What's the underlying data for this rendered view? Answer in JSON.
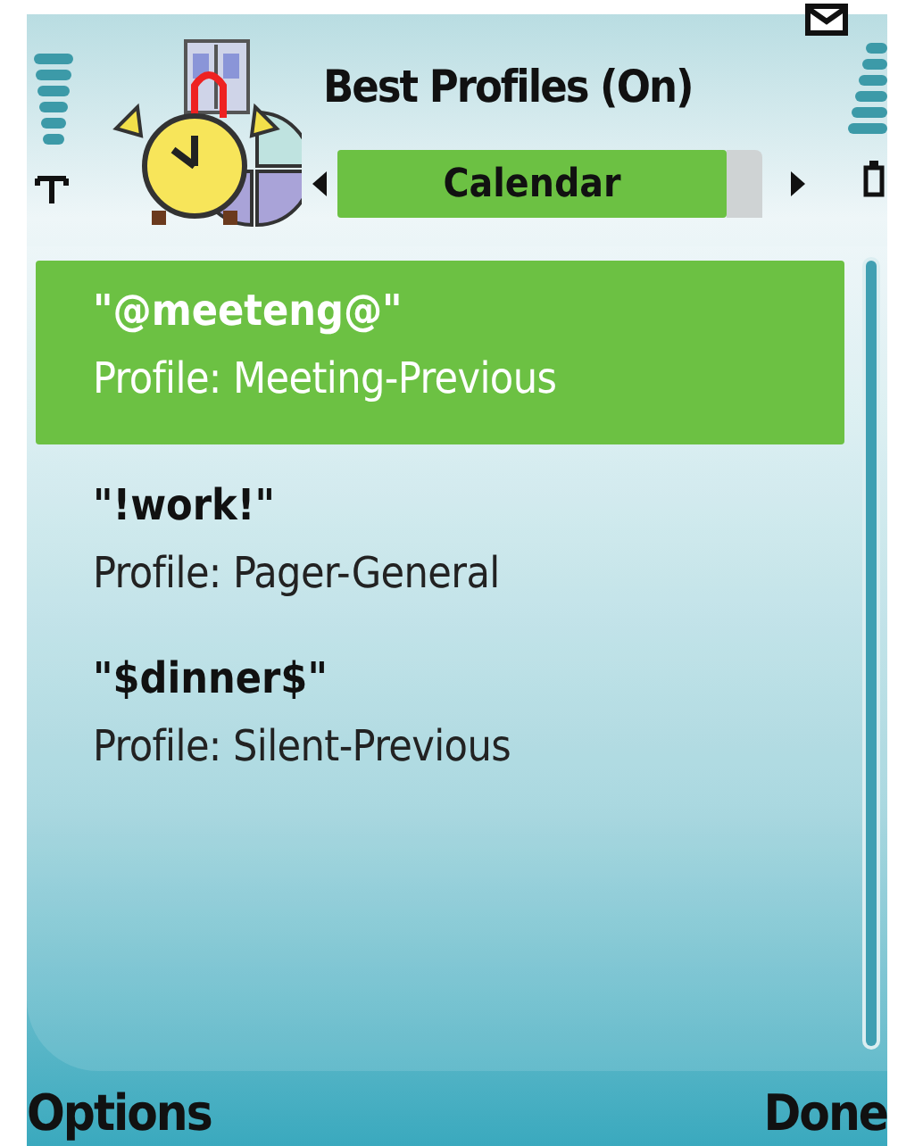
{
  "title": "Best Profiles (On)",
  "tab": {
    "label": "Calendar"
  },
  "items": [
    {
      "title": "\"@meeteng@\"",
      "subtitle": "Profile: Meeting-Previous",
      "selected": true
    },
    {
      "title": "\"!work!\"",
      "subtitle": "Profile: Pager-General",
      "selected": false
    },
    {
      "title": "\"$dinner$\"",
      "subtitle": "Profile: Silent-Previous",
      "selected": false
    }
  ],
  "softkeys": {
    "left": "Options",
    "right": "Done"
  }
}
